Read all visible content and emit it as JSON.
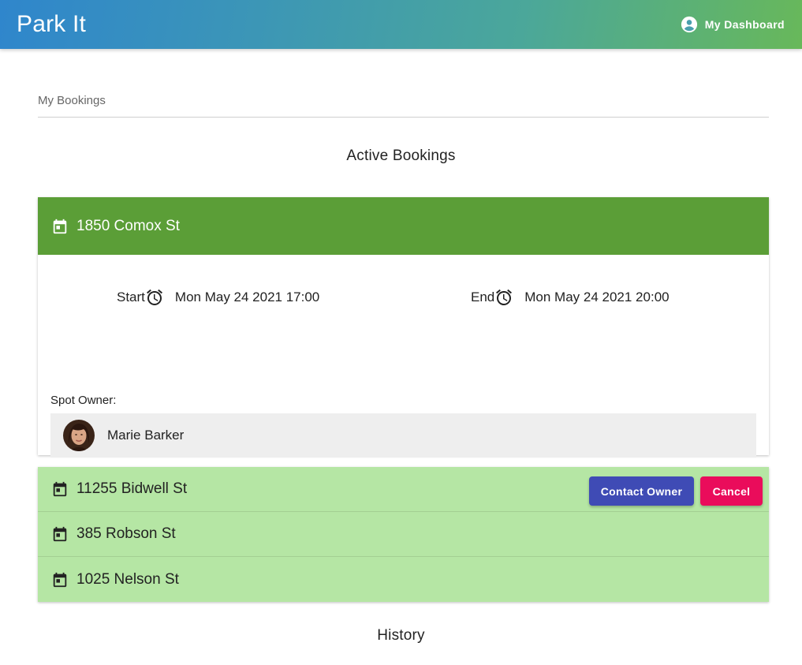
{
  "app": {
    "brand": "Park It",
    "dashboard_label": "My Dashboard"
  },
  "page": {
    "section_label": "My Bookings",
    "active_heading": "Active Bookings",
    "history_heading": "History"
  },
  "active_booking": {
    "address": "1850 Comox St",
    "start_label": "Start",
    "start_value": "Mon May 24 2021 17:00",
    "end_label": "End",
    "end_value": "Mon May 24 2021 20:00",
    "owner_label": "Spot Owner:",
    "owner_name": "Marie Barker",
    "contact_label": "Contact Owner",
    "cancel_label": "Cancel"
  },
  "other_bookings": [
    {
      "address": "11255 Bidwell St"
    },
    {
      "address": "385 Robson St"
    },
    {
      "address": "1025 Nelson St"
    }
  ],
  "colors": {
    "expanded_header": "#5b9e37",
    "collapsed_bg": "#b5e6a4",
    "contact_button": "#3f4bb5",
    "cancel_button": "#ea0c5b"
  }
}
